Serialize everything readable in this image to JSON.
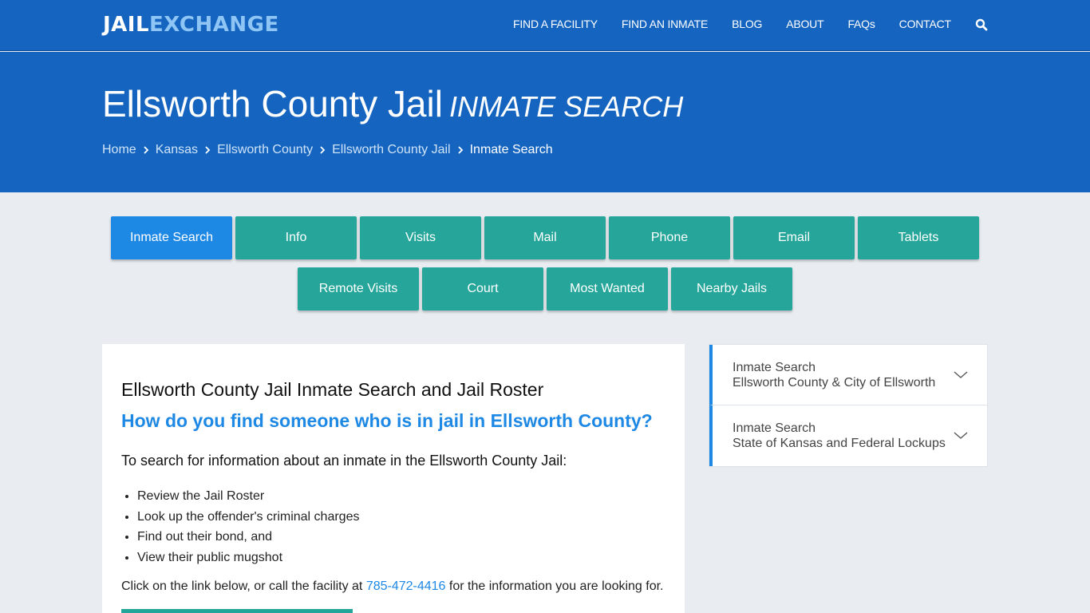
{
  "header": {
    "logo_part1": "JAIL",
    "logo_part2": "EXCHANGE",
    "nav": [
      {
        "label": "FIND A FACILITY"
      },
      {
        "label": "FIND AN INMATE"
      },
      {
        "label": "BLOG"
      },
      {
        "label": "ABOUT"
      },
      {
        "label": "FAQs"
      },
      {
        "label": "CONTACT"
      }
    ],
    "search_icon": "search-icon"
  },
  "hero": {
    "title": "Ellsworth County Jail",
    "subtitle": "Inmate Search",
    "breadcrumb": [
      {
        "label": "Home"
      },
      {
        "label": "Kansas"
      },
      {
        "label": "Ellsworth County"
      },
      {
        "label": "Ellsworth County Jail"
      },
      {
        "label": "Inmate Search"
      }
    ]
  },
  "tabs": {
    "row1": [
      {
        "label": "Inmate Search",
        "active": true
      },
      {
        "label": "Info"
      },
      {
        "label": "Visits"
      },
      {
        "label": "Mail"
      },
      {
        "label": "Phone"
      },
      {
        "label": "Email"
      },
      {
        "label": "Tablets"
      }
    ],
    "row2": [
      {
        "label": "Remote Visits"
      },
      {
        "label": "Court"
      },
      {
        "label": "Most Wanted"
      },
      {
        "label": "Nearby Jails"
      }
    ]
  },
  "main": {
    "heading": "Ellsworth County Jail Inmate Search and Jail Roster",
    "question": "How do you find someone who is in jail in Ellsworth County?",
    "lead": "To search for information about an inmate in the Ellsworth County Jail:",
    "bullets": [
      "Review the Jail Roster",
      "Look up the offender's criminal charges",
      "Find out their bond, and",
      "View their public mugshot"
    ],
    "para_before": "Click on the link below, or call the facility at ",
    "phone": "785-472-4416",
    "para_after": " for the information you are looking for."
  },
  "sidebar": {
    "items": [
      {
        "line1": "Inmate Search",
        "line2": "Ellsworth County & City of Ellsworth"
      },
      {
        "line1": "Inmate Search",
        "line2": "State of Kansas and Federal Lockups"
      }
    ]
  },
  "colors": {
    "brand_blue": "#1565c0",
    "active_tab": "#1e88e5",
    "tab_teal": "#26a69a",
    "link_blue": "#1e88e5"
  }
}
